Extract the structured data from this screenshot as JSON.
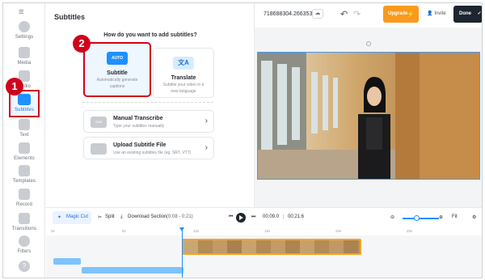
{
  "rail": {
    "items": [
      {
        "label": "Settings",
        "icon": "gear-icon"
      },
      {
        "label": "Media",
        "icon": "plus-icon"
      },
      {
        "label": "Audio",
        "icon": "music-icon"
      },
      {
        "label": "Subtitles",
        "icon": "subtitles-icon"
      },
      {
        "label": "Text",
        "icon": "text-icon"
      },
      {
        "label": "Elements",
        "icon": "elements-icon"
      },
      {
        "label": "Templates",
        "icon": "templates-icon"
      },
      {
        "label": "Record",
        "icon": "record-icon"
      },
      {
        "label": "Transitions",
        "icon": "transitions-icon"
      },
      {
        "label": "Filters",
        "icon": "filters-icon"
      },
      {
        "label": "?",
        "icon": "help-icon"
      }
    ],
    "callout": "1"
  },
  "panel": {
    "title": "Subtitles",
    "question": "How do you want to add subtitles?",
    "callout": "2",
    "cards": [
      {
        "badge": "AUTO",
        "title": "Subtitle",
        "sub1": "Automatically generate",
        "sub2": "captions"
      },
      {
        "badge": "文A",
        "title": "Translate",
        "sub1": "Subtitle your video in a",
        "sub2": "new language"
      }
    ],
    "rows": [
      {
        "badge": "SUB",
        "title": "Manual Transcribe",
        "sub": "Type your subtitles manually"
      },
      {
        "badge": "",
        "title": "Upload Subtitle File",
        "sub": "Use an existing subtitles file (eg. SRT, VTT)"
      }
    ]
  },
  "topbar": {
    "project": "718688304.266353",
    "upgrade": "Upgrade",
    "invite": "Invite",
    "done": "Done"
  },
  "timeline": {
    "magic_cut": "Magic Cut",
    "split": "Split",
    "download": "Download Section",
    "range": "(0:08 - 0:21)",
    "current": "00:09.0",
    "total": "00:21.6",
    "fit": "Fit",
    "ticks": [
      "0s",
      "5s",
      "10s",
      "15s",
      "20s",
      "25s"
    ]
  },
  "colors": {
    "accent": "#1e90ff",
    "callout": "#d0021b",
    "upgrade": "#f99a1c",
    "done": "#1d2530"
  }
}
